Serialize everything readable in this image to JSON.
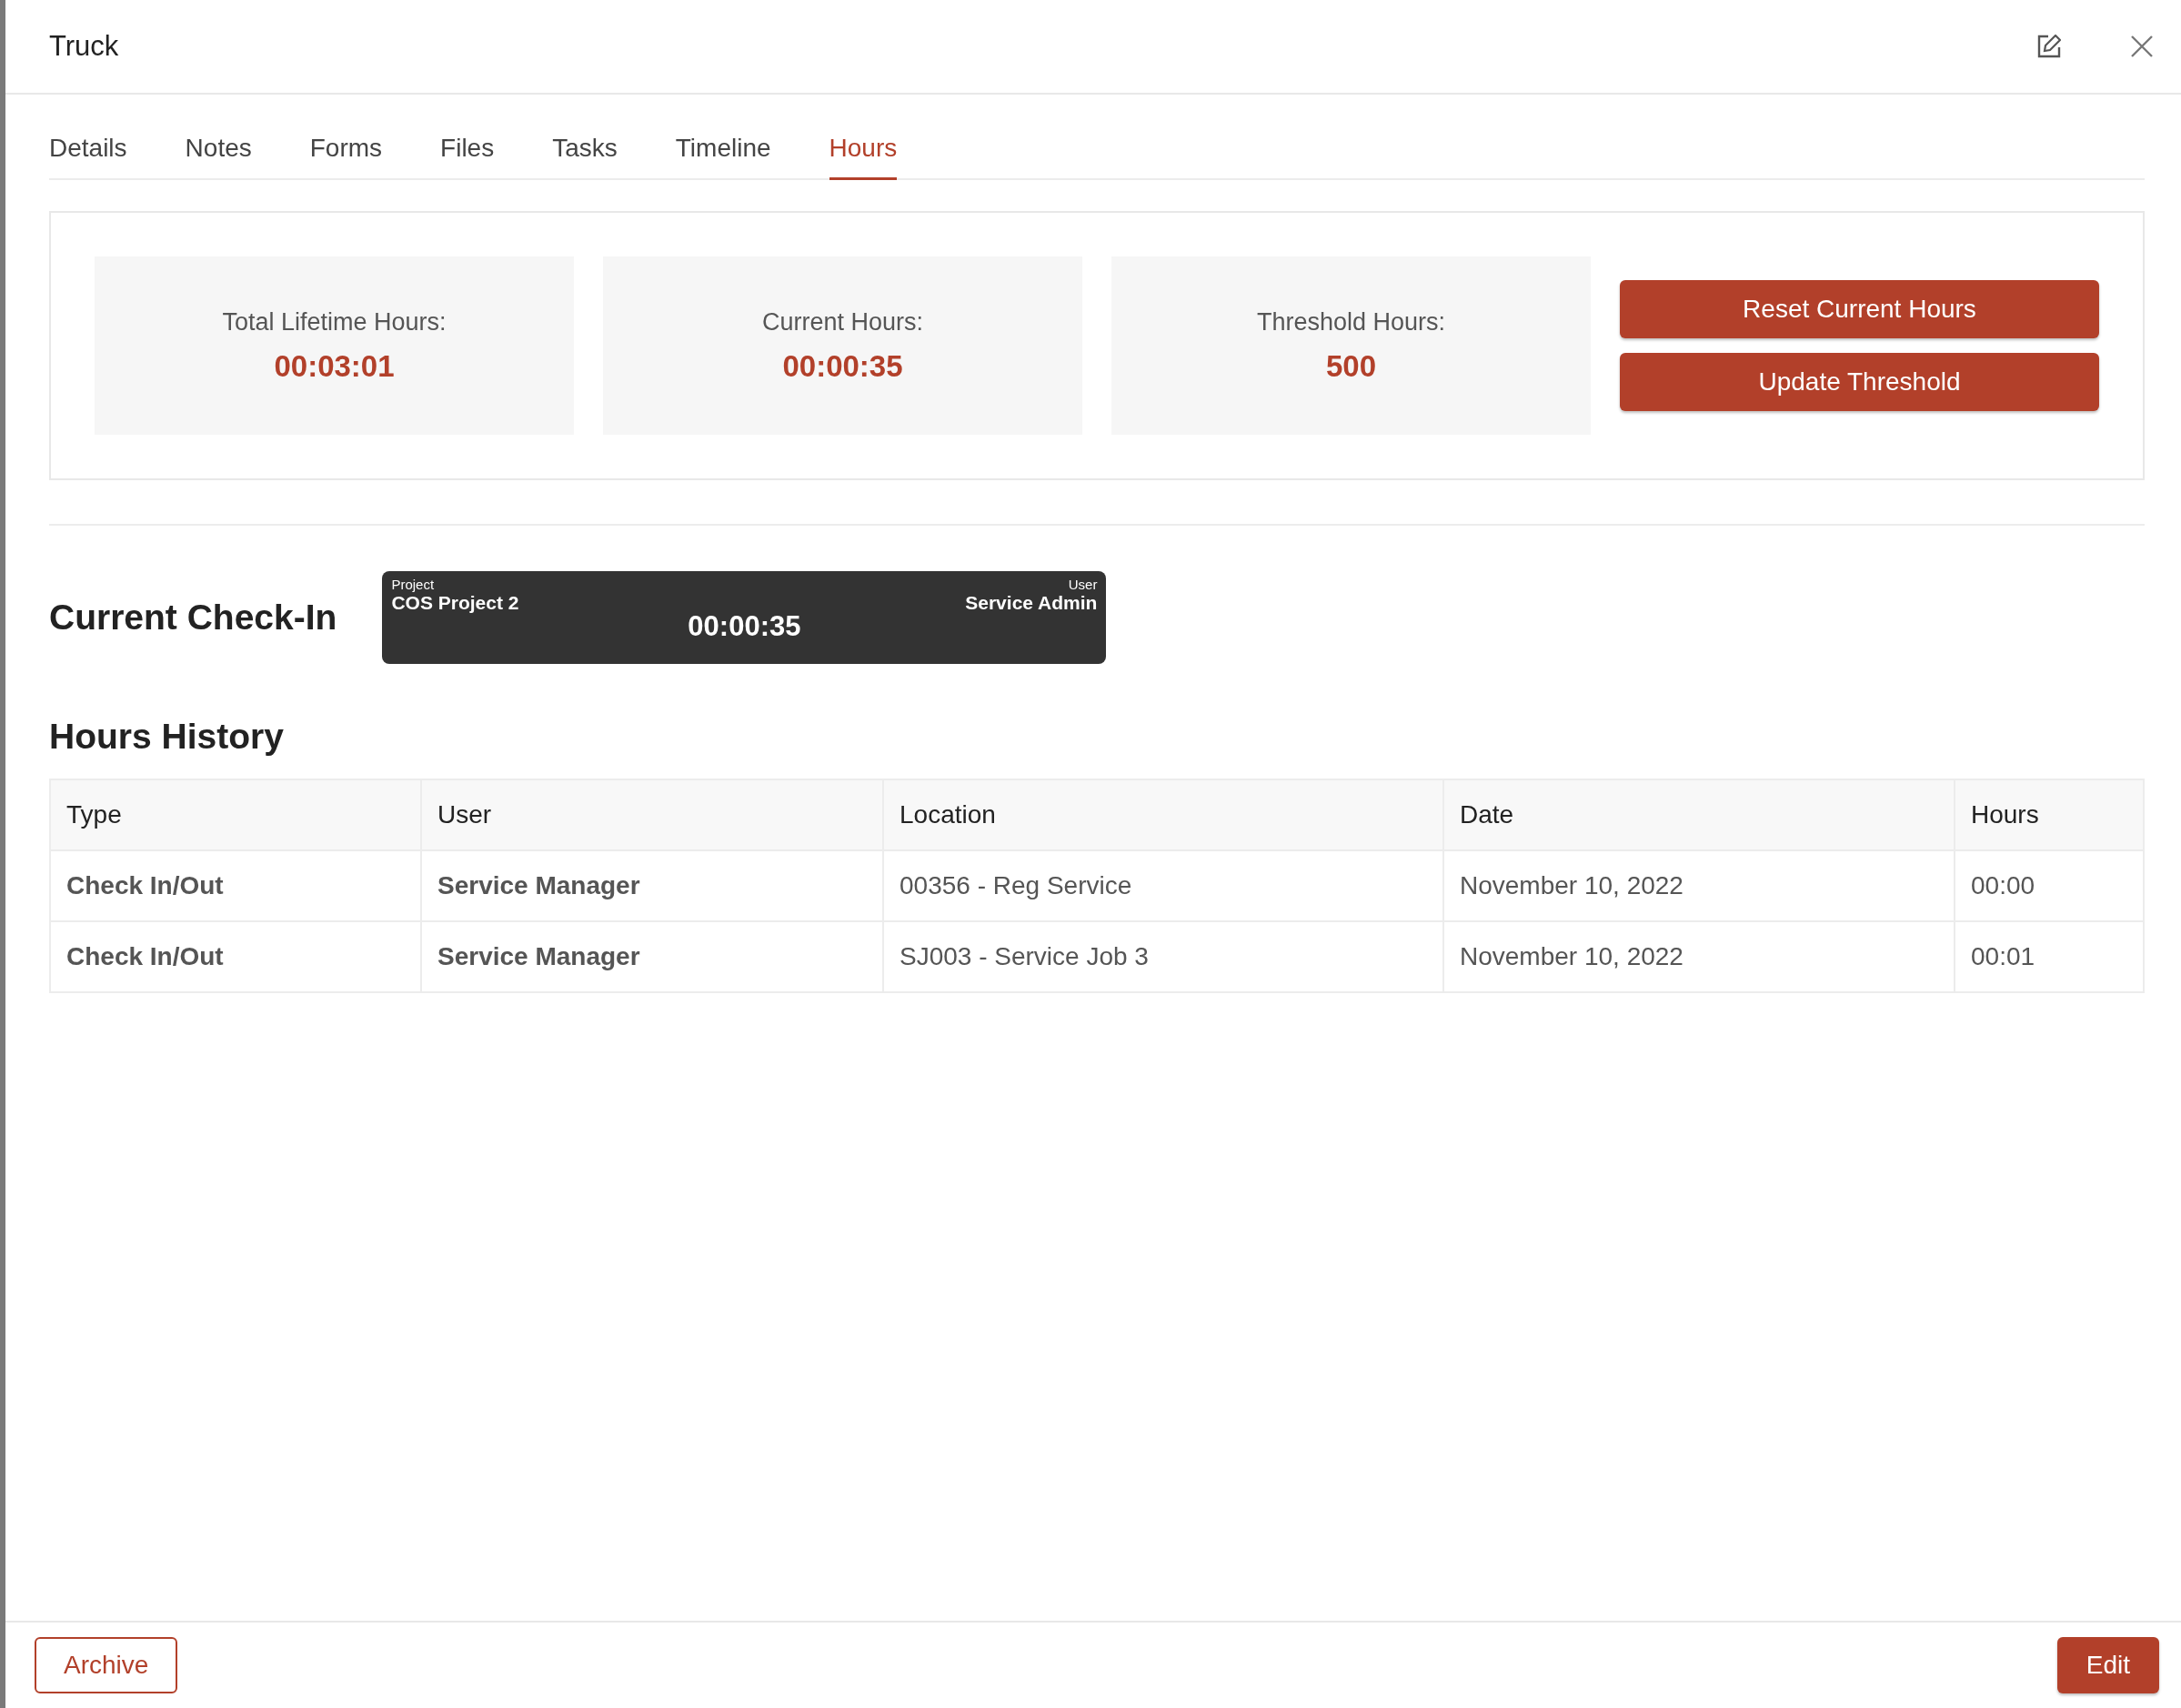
{
  "window": {
    "title": "Truck"
  },
  "tabs": [
    {
      "label": "Details",
      "selected": false
    },
    {
      "label": "Notes",
      "selected": false
    },
    {
      "label": "Forms",
      "selected": false
    },
    {
      "label": "Files",
      "selected": false
    },
    {
      "label": "Tasks",
      "selected": false
    },
    {
      "label": "Timeline",
      "selected": false
    },
    {
      "label": "Hours",
      "selected": true
    }
  ],
  "stats": [
    {
      "label": "Total Lifetime Hours:",
      "value": "00:03:01"
    },
    {
      "label": "Current Hours:",
      "value": "00:00:35"
    },
    {
      "label": "Threshold Hours:",
      "value": "500"
    }
  ],
  "stat_buttons": [
    "Reset Current Hours",
    "Update Threshold"
  ],
  "check_in": {
    "heading": "Current Check-In",
    "project_label": "Project",
    "project": "COS Project 2",
    "user_label": "User",
    "user": "Service Admin",
    "timer": "00:00:35"
  },
  "history": {
    "heading": "Hours History",
    "columns": [
      "Type",
      "User",
      "Location",
      "Date",
      "Hours"
    ],
    "rows": [
      [
        "Check In/Out",
        "Service Manager",
        "00356 - Reg Service",
        "November 10, 2022",
        "00:00"
      ],
      [
        "Check In/Out",
        "Service Manager",
        "SJ003 - Service Job 3",
        "November 10, 2022",
        "00:01"
      ]
    ]
  },
  "footer": {
    "left_button": "Archive",
    "right_button": "Edit"
  }
}
